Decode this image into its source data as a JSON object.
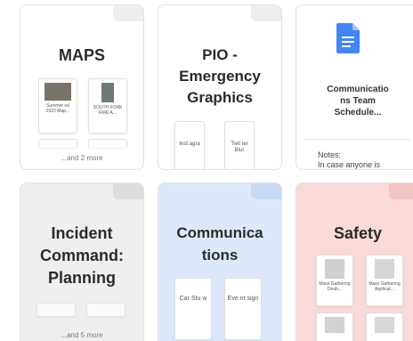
{
  "cards": [
    {
      "title": "MAPS",
      "items": [
        {
          "label": "Summer ed 2022 Map..."
        },
        {
          "label": "SOUTH FORK FIRE A..."
        }
      ],
      "more": "...and 2 more"
    },
    {
      "title_lines": [
        "PIO -",
        "Emergency",
        "Graphics"
      ],
      "items": [
        {
          "label": "Inst agra"
        },
        {
          "label": "Twit ter Blur"
        }
      ]
    },
    {
      "doc_title_lines": [
        "Communicatio",
        "ns Team",
        "Schedule..."
      ],
      "notes_label": "Notes:",
      "notes_text": "In case anyone is"
    },
    {
      "title_lines": [
        "Incident",
        "Command:",
        "Planning"
      ],
      "more": "...and 5 more"
    },
    {
      "title_lines": [
        "Communica",
        "tions"
      ],
      "items": [
        {
          "label": "Car Stu w"
        },
        {
          "label": "Eve nt sign"
        }
      ]
    },
    {
      "title": "Safety",
      "items": [
        {
          "label": "Mass Gathering Doub..."
        },
        {
          "label": "Mass Gathering Applicat..."
        }
      ]
    }
  ],
  "colors": {
    "card_grey": "#efefef",
    "card_blue": "#dde9fb",
    "card_pink": "#fbdada",
    "doc_blue": "#4285f4"
  },
  "icons": {
    "doc": "google-docs-icon"
  }
}
